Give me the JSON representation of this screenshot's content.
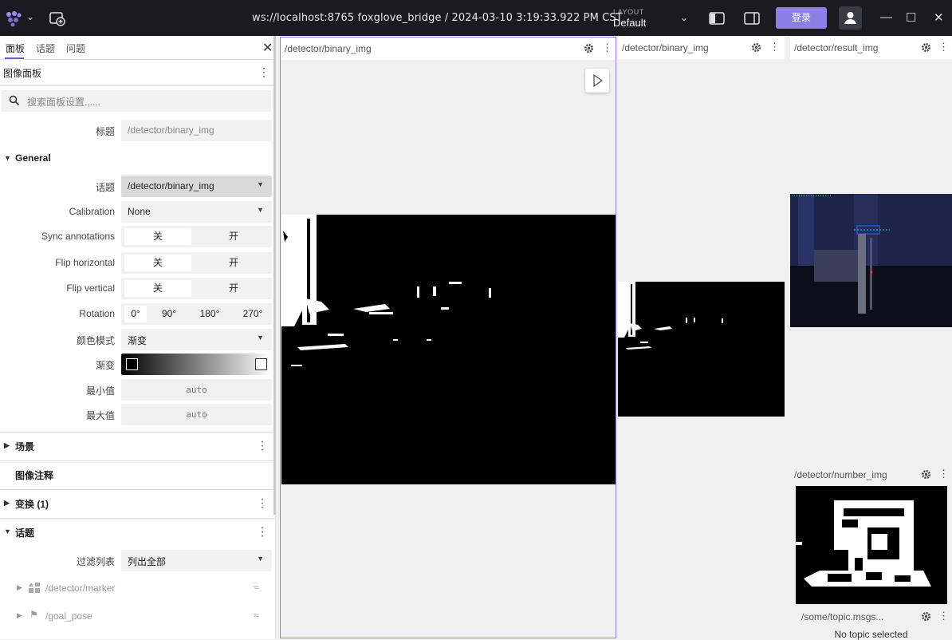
{
  "topbar": {
    "connection": "ws://localhost:8765 foxglove_bridge / 2024-03-10 3:19:33.922 PM CST",
    "layout_label": "LAYOUT",
    "layout_value": "Default",
    "login_label": "登录",
    "brand_color": "#8b7fe8"
  },
  "sidebar": {
    "tabs": [
      "面板",
      "话题",
      "问题"
    ],
    "panel_title": "图像面板",
    "search_placeholder": "搜索面板设置......",
    "title_label": "标题",
    "title_placeholder": "/detector/binary_img",
    "general": {
      "header": "General",
      "topic_label": "话题",
      "topic_value": "/detector/binary_img",
      "calibration_label": "Calibration",
      "calibration_value": "None",
      "sync_label": "Sync annotations",
      "flip_h_label": "Flip horizontal",
      "flip_v_label": "Flip vertical",
      "off": "关",
      "on": "开",
      "rotation_label": "Rotation",
      "rotations": [
        "0°",
        "90°",
        "180°",
        "270°"
      ],
      "color_mode_label": "颜色模式",
      "color_mode_value": "渐变",
      "gradient_label": "渐变",
      "min_label": "最小值",
      "min_value": "auto",
      "max_label": "最大值",
      "max_value": "auto"
    },
    "sections": {
      "scene": "场景",
      "annotations": "图像注释",
      "transforms": "变换 (1)",
      "topics": "话题"
    },
    "topics": {
      "filter_label": "过滤列表",
      "filter_value": "列出全部",
      "items": [
        "/detector/marker",
        "/goal_pose"
      ]
    }
  },
  "panes": {
    "p1_title": "/detector/binary_img",
    "p2_title": "/detector/binary_img",
    "p3_title": "/detector/result_img",
    "p4_title": "/detector/number_img",
    "p5_title": "/some/topic.msgs...",
    "p5_empty": "No topic selected"
  }
}
